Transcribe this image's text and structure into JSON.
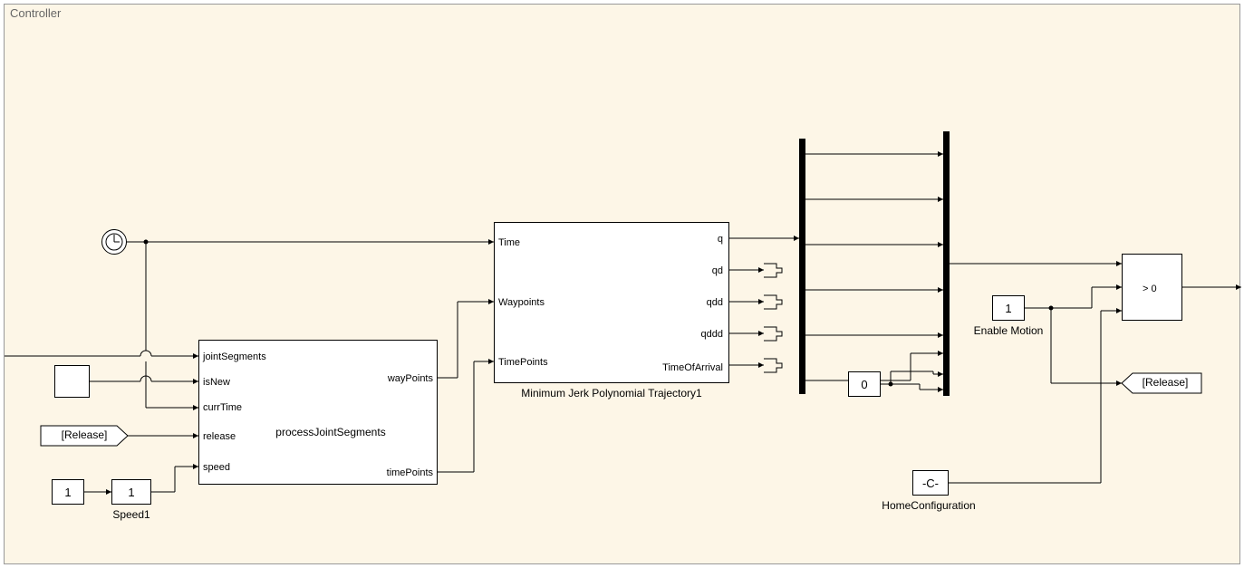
{
  "subsystem_title": "Controller",
  "clock_block": "clock",
  "step_block": "step",
  "from_release": "[Release]",
  "const_one": "1",
  "gain_one": "1",
  "speed1_label": "Speed1",
  "process_block": {
    "ports_in": [
      "jointSegments",
      "isNew",
      "currTime",
      "release",
      "speed"
    ],
    "ports_out": [
      "wayPoints",
      "timePoints"
    ],
    "name": "processJointSegments"
  },
  "traj_block": {
    "ports_in": [
      "Time",
      "Waypoints",
      "TimePoints"
    ],
    "ports_out": [
      "q",
      "qd",
      "qdd",
      "qddd",
      "TimeOfArrival"
    ],
    "label": "Minimum Jerk Polynomial Trajectory1"
  },
  "enable_motion": {
    "value": "1",
    "label": "Enable Motion"
  },
  "const_zero": "0",
  "home_config": {
    "value": "-C-",
    "label": "HomeConfiguration"
  },
  "switch_condition": "> 0",
  "goto_release": "[Release]"
}
